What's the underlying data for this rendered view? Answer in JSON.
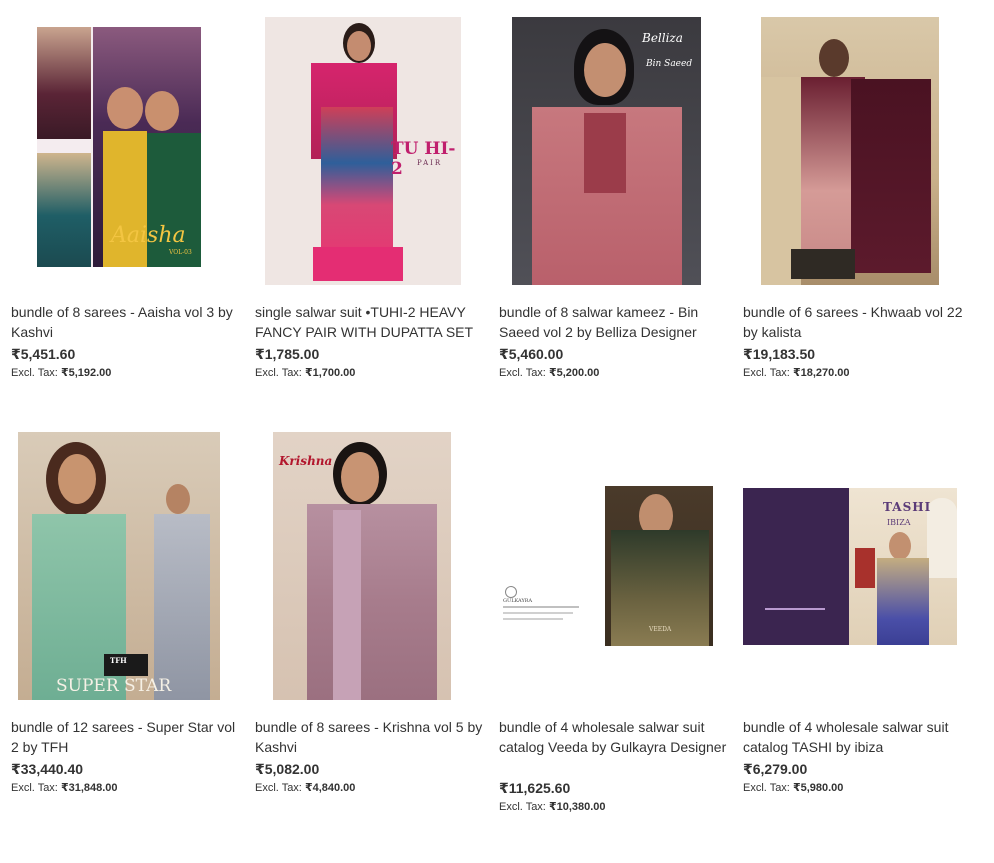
{
  "products": [
    {
      "image_alt": "Aaisha saree catalog cover",
      "cover_text": "Aaisha",
      "cover_sub": "VOL-03",
      "title": "bundle of 8 sarees - Aaisha vol 3 by Kashvi",
      "price": "₹5,451.60",
      "excl_label": "Excl. Tax:",
      "excl_price": "₹5,192.00"
    },
    {
      "image_alt": "TUHI-2 salwar suit",
      "cover_text": "TU HI-2",
      "cover_sub": "PAIR",
      "title": "single salwar suit •TUHI-2 HEAVY FANCY PAIR WITH DUPATTA SET",
      "price": "₹1,785.00",
      "excl_label": "Excl. Tax:",
      "excl_price": "₹1,700.00"
    },
    {
      "image_alt": "Bin Saeed salwar kameez",
      "cover_text": "Belliza",
      "cover_sub": "Bin Saeed",
      "title": "bundle of 8 salwar kameez - Bin Saeed vol 2 by Belliza Designer",
      "price": "₹5,460.00",
      "excl_label": "Excl. Tax:",
      "excl_price": "₹5,200.00"
    },
    {
      "image_alt": "Khwaab saree catalog",
      "cover_text": "",
      "cover_sub": "",
      "title": "bundle of 6 sarees - Khwaab vol 22 by kalista",
      "price": "₹19,183.50",
      "excl_label": "Excl. Tax:",
      "excl_price": "₹18,270.00"
    },
    {
      "image_alt": "Super Star saree catalog",
      "cover_text": "SUPER STAR",
      "cover_sub": "TFH",
      "title": "bundle of 12 sarees - Super Star vol 2 by TFH",
      "price": "₹33,440.40",
      "excl_label": "Excl. Tax:",
      "excl_price": "₹31,848.00"
    },
    {
      "image_alt": "Krishna saree catalog",
      "cover_text": "Krishna",
      "cover_sub": "",
      "title": "bundle of 8 sarees - Krishna vol 5 by Kashvi",
      "price": "₹5,082.00",
      "excl_label": "Excl. Tax:",
      "excl_price": "₹4,840.00"
    },
    {
      "image_alt": "Veeda salwar suit catalog",
      "cover_text": "VEEDA",
      "cover_sub": "GULKAYRA",
      "title": "bundle of 4 wholesale salwar suit catalog Veeda by Gulkayra Designer",
      "price": "₹11,625.60",
      "excl_label": "Excl. Tax:",
      "excl_price": "₹10,380.00"
    },
    {
      "image_alt": "Tashi salwar suit catalog",
      "cover_text": "TASHI",
      "cover_sub": "IBIZA",
      "title": "bundle of 4 wholesale salwar suit catalog TASHI by ibiza",
      "price": "₹6,279.00",
      "excl_label": "Excl. Tax:",
      "excl_price": "₹5,980.00"
    }
  ]
}
